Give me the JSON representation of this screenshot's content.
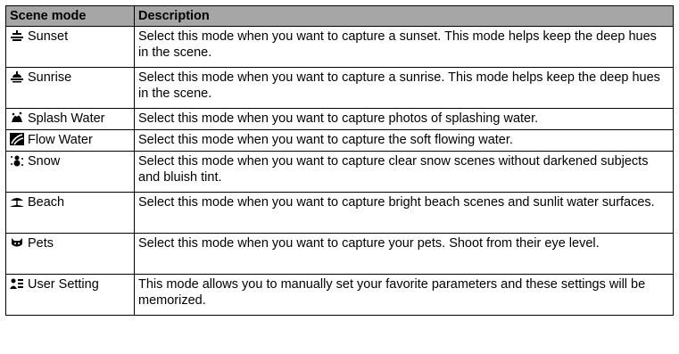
{
  "header": {
    "col_mode": "Scene mode",
    "col_desc": "Description"
  },
  "rows": [
    {
      "icon": "sunset-icon",
      "mode": "Sunset",
      "description": "Select this mode when you want to capture a sunset. This mode helps keep the deep hues in the scene."
    },
    {
      "icon": "sunrise-icon",
      "mode": "Sunrise",
      "description": "Select this mode when you want to capture a sunrise. This mode helps keep the deep hues in the scene."
    },
    {
      "icon": "splash-water-icon",
      "mode": "Splash Water",
      "description": "Select this mode when you want to capture photos of splashing water."
    },
    {
      "icon": "flow-water-icon",
      "mode": "Flow Water",
      "description": "Select this mode when you want to capture the soft flowing water."
    },
    {
      "icon": "snow-icon",
      "mode": "Snow",
      "description": "Select this mode when you want to capture clear snow scenes without darkened subjects and bluish tint."
    },
    {
      "icon": "beach-icon",
      "mode": "Beach",
      "description": "Select this mode when you want to capture bright beach scenes and sunlit water surfaces."
    },
    {
      "icon": "pets-icon",
      "mode": "Pets",
      "description": "Select this mode when you want to capture your pets. Shoot from their eye level."
    },
    {
      "icon": "user-setting-icon",
      "mode": "User Setting",
      "description": "This mode allows you to manually set your favorite parameters and these settings will be memorized."
    }
  ]
}
